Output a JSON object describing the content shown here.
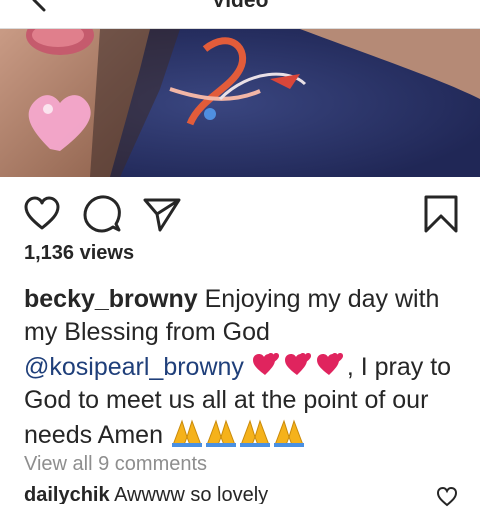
{
  "header": {
    "title": "Video",
    "back_icon": "back-arrow-icon"
  },
  "post": {
    "views": "1,136 views",
    "caption": {
      "username": "becky_browny",
      "text_1": " Enjoying my day with my Blessing from God ",
      "mention": "@kosipearl_browny",
      "text_2": ", I pray to God to meet us all at the point of our needs Amen "
    },
    "view_all_comments": "View all 9 comments",
    "next_comment": {
      "username": "dailychik",
      "text": "Awwww so lovely"
    }
  },
  "icons": {
    "like": "heart-icon",
    "comment": "comment-icon",
    "share": "send-icon",
    "save": "bookmark-icon",
    "emoji_1": "two-hearts-emoji",
    "emoji_2": "folded-hands-emoji"
  },
  "colors": {
    "mention": "#1f3f7a",
    "muted": "#8e8e8e",
    "text": "#262626",
    "heart_emoji": "#e0245e",
    "hands_emoji": "#f5b21b"
  }
}
